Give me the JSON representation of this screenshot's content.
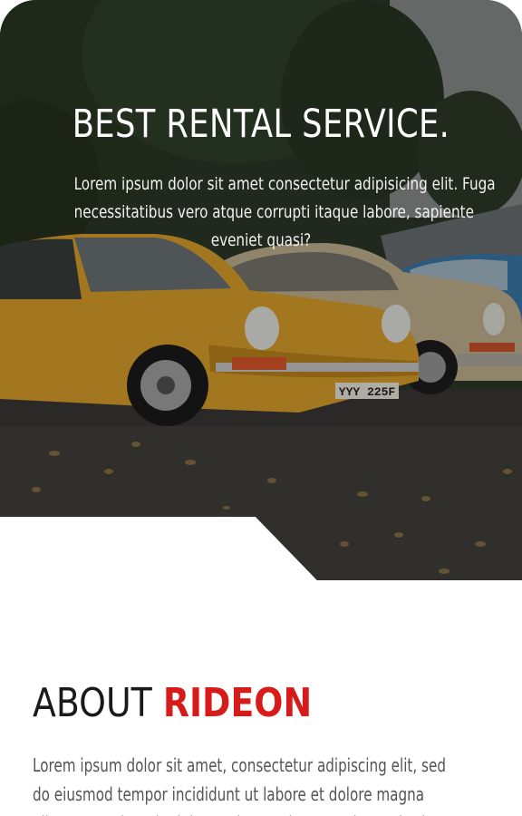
{
  "hero": {
    "title": "BEST RENTAL SERVICE.",
    "text_lines": [
      "Lorem ipsum dolor sit amet consectetur adipisicing elit. Fuga",
      "necessitatibus vero atque corrupti itaque labore, sapiente",
      "eveniet quasi?"
    ],
    "plate": "YYY 225F"
  },
  "about": {
    "heading_plain": "ABOUT",
    "heading_accent": "RIDEON",
    "text_lines": [
      "Lorem ipsum dolor sit amet, consectetur adipiscing elit, sed",
      "do eiusmod tempor incididunt ut labore et dolore magna",
      "aliqua. Ut enim ad minim veniam, quis nostrud exercitation"
    ]
  },
  "colors": {
    "accent": "#d71a1a",
    "car_yellow": "#e2a62c",
    "car_beige": "#c8b894",
    "car_blue": "#3b7fb0"
  }
}
